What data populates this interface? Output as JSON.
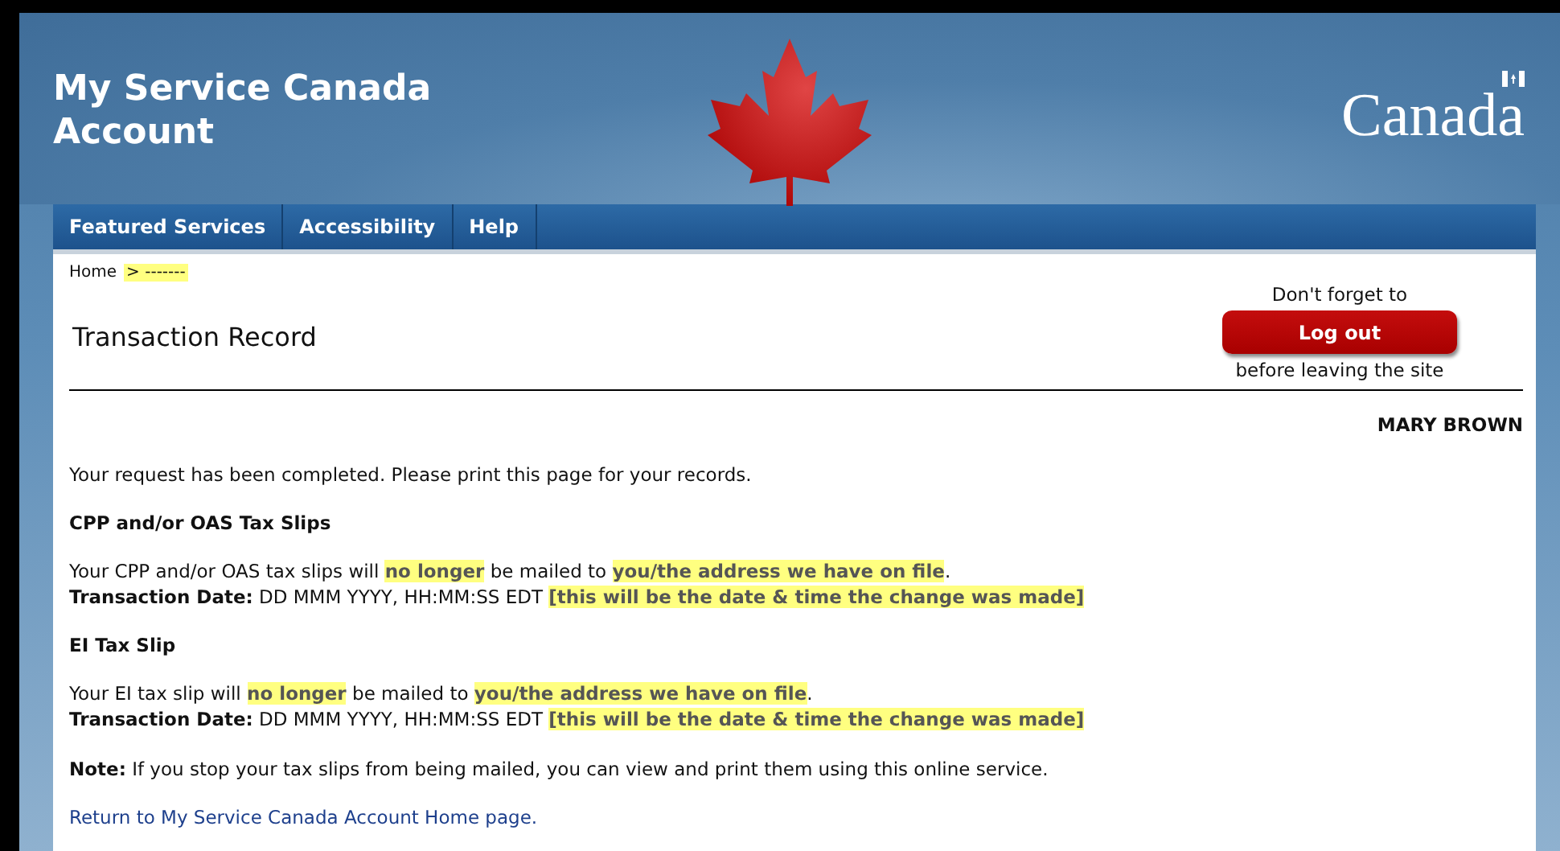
{
  "header": {
    "title": "My Service Canada Account",
    "wordmark": "Canada"
  },
  "nav": [
    {
      "label": "Featured Services"
    },
    {
      "label": "Accessibility"
    },
    {
      "label": "Help"
    }
  ],
  "breadcrumb": {
    "home": "Home",
    "separator": ">",
    "current": "-------"
  },
  "page_title": "Transaction Record",
  "logout": {
    "before": "Don't forget to",
    "button": "Log out",
    "after": "before leaving the site"
  },
  "user_name": "MARY BROWN",
  "intro": "Your request has been completed. Please print this page for your records.",
  "sections": [
    {
      "heading": "CPP and/or OAS Tax Slips",
      "message": [
        {
          "kind": "plain",
          "text": "Your CPP and/or OAS tax slips will "
        },
        {
          "kind": "highlight",
          "text": "no longer"
        },
        {
          "kind": "plain",
          "text": " be mailed to "
        },
        {
          "kind": "highlight",
          "text": "you/the address we have on file"
        },
        {
          "kind": "plain",
          "text": "."
        }
      ],
      "date": [
        {
          "kind": "bold",
          "text": "Transaction Date:"
        },
        {
          "kind": "plain",
          "text": " DD MMM YYYY, HH:MM:SS EDT "
        },
        {
          "kind": "highlight",
          "text": "[this will be the date & time the change was made]"
        }
      ]
    },
    {
      "heading": "EI Tax Slip",
      "message": [
        {
          "kind": "plain",
          "text": "Your EI tax slip will "
        },
        {
          "kind": "highlight",
          "text": "no longer"
        },
        {
          "kind": "plain",
          "text": " be mailed to "
        },
        {
          "kind": "highlight",
          "text": "you/the address we have on file"
        },
        {
          "kind": "plain",
          "text": "."
        }
      ],
      "date": [
        {
          "kind": "bold",
          "text": "Transaction Date:"
        },
        {
          "kind": "plain",
          "text": " DD MMM YYYY, HH:MM:SS EDT "
        },
        {
          "kind": "highlight",
          "text": "[this will be the date & time the change was made]"
        }
      ]
    }
  ],
  "note": "**Note:** If you stop your tax slips from being mailed, you can view and print them using this online service.",
  "return_link": "Return to My Service Canada Account Home page."
}
